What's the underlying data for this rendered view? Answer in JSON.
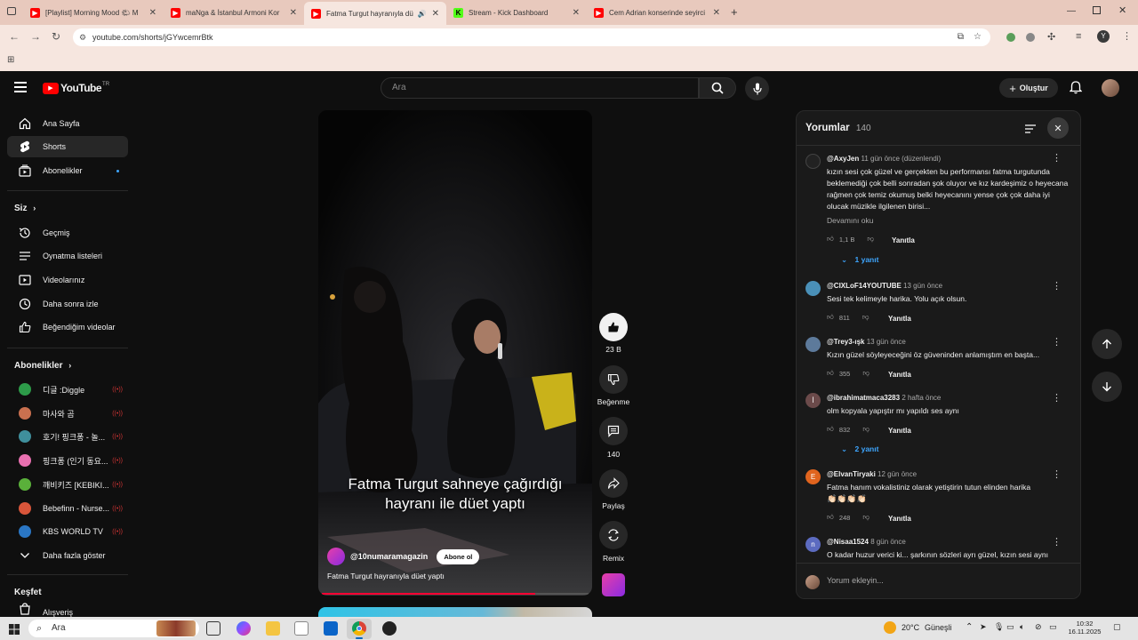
{
  "browser": {
    "tabs": [
      {
        "title": "[Playlist] Morning Mood 🌤 M",
        "favicon_color": "#ff0000"
      },
      {
        "title": "maNga & İstanbul Armoni Kor",
        "favicon_color": "#ff0000"
      },
      {
        "title": "Fatma Turgut hayranıyla dü",
        "favicon_color": "#ff0000",
        "active": true
      },
      {
        "title": "Stream - Kick Dashboard",
        "favicon_color": "#53fc18",
        "favicon_letter": "K"
      },
      {
        "title": "Cem Adrian konserinde seyirci",
        "favicon_color": "#ff0000"
      }
    ],
    "url": "youtube.com/shorts/jGYwcemrBtk",
    "profile_initial": "Y"
  },
  "youtube": {
    "logo_text": "YouTube",
    "logo_region": "TR",
    "search_placeholder": "Ara",
    "create_label": "Oluştur",
    "sidebar": {
      "main": [
        {
          "label": "Ana Sayfa",
          "icon": "home-icon"
        },
        {
          "label": "Shorts",
          "icon": "shorts-icon",
          "active": true
        },
        {
          "label": "Abonelikler",
          "icon": "subscriptions-icon"
        }
      ],
      "you_header": "Siz",
      "you": [
        {
          "label": "Geçmiş",
          "icon": "history-icon"
        },
        {
          "label": "Oynatma listeleri",
          "icon": "playlist-icon"
        },
        {
          "label": "Videolarınız",
          "icon": "video-icon"
        },
        {
          "label": "Daha sonra izle",
          "icon": "clock-icon"
        },
        {
          "label": "Beğendiğim videolar",
          "icon": "like-icon"
        }
      ],
      "subs_header": "Abonelikler",
      "subs": [
        {
          "label": "디글 :Diggle",
          "color": "#2d9b49",
          "live": "((•))"
        },
        {
          "label": "마사와 곰",
          "color": "#c9704f",
          "live": "((•))"
        },
        {
          "label": "호기! 핑크퐁 - 놀...",
          "color": "#3f8f9c",
          "live": "((•))"
        },
        {
          "label": "핑크퐁 (인기 동요...",
          "color": "#e870b0",
          "live": "((•))"
        },
        {
          "label": "깨비키즈 [KEBIKI...",
          "color": "#5ab03a",
          "live": "((•))"
        },
        {
          "label": "Bebefinn - Nurse...",
          "color": "#d8553a",
          "live": "((•))"
        },
        {
          "label": "KBS WORLD TV",
          "color": "#2a76c4",
          "live": "((•))"
        }
      ],
      "more_label": "Daha fazla göster",
      "explore_header": "Keşfet",
      "explore": [
        {
          "label": "Alışveriş",
          "icon": "shopping-icon"
        }
      ]
    },
    "video": {
      "caption_line1": "Fatma Turgut sahneye çağırdığı",
      "caption_line2": "hayranı ile düet yaptı",
      "channel": "@10numaramagazin",
      "subscribe_label": "Abone ol",
      "title": "Fatma Turgut hayranıyla düet yaptı",
      "progress": 0.8
    },
    "actions": {
      "likes": "23 B",
      "dislike_label": "Beğenme",
      "comments": "140",
      "share_label": "Paylaş",
      "remix_label": "Remix"
    },
    "comments_panel": {
      "title": "Yorumlar",
      "count": "140",
      "input_placeholder": "Yorum ekleyin...",
      "reply_label": "Yanıtla",
      "read_more": "Devamını oku",
      "items": [
        {
          "author": "@AxyJen",
          "time": "11 gün önce (düzenlendi)",
          "text": "kızın sesi çok güzel ve gerçekten bu performansı fatma turgutunda beklemediği çok belli sonradan şok oluyor ve kız kardeşimiz o heyecana rağmen çok temiz okumuş belki heyecanını yense çok çok daha iyi olucak müzikle ilgilenen birisi...",
          "likes": "1,1 B",
          "replies": "1 yanıt",
          "avatar_color": "#222"
        },
        {
          "author": "@CIXLoF14YOUTUBE",
          "time": "13 gün önce",
          "text": "Sesi tek kelimeyle harika. Yolu açık olsun.",
          "likes": "811",
          "avatar_color": "#4a90b8"
        },
        {
          "author": "@Trey3-ışk",
          "time": "13 gün önce",
          "text": "Kızın güzel söyleyeceğini öz güveninden anlamıştım en başta...",
          "likes": "355",
          "avatar_color": "#5d7a9b"
        },
        {
          "author": "@ibrahimatmaca3283",
          "time": "2 hafta önce",
          "text": "olm kopyala yapıştır mı yapıldı ses aynı",
          "likes": "832",
          "replies": "2 yanıt",
          "avatar_color": "#6b4a4a",
          "avatar_letter": "İ"
        },
        {
          "author": "@ElvanTiryaki",
          "time": "12 gün önce",
          "text": "Fatma hanım vokalistiniz olarak yetiştirin tutun elinden harika",
          "emoji": "👏🏻👏🏻👏🏻👏🏻",
          "likes": "248",
          "avatar_color": "#e0641e",
          "avatar_letter": "E"
        },
        {
          "author": "@Nisaa1524",
          "time": "8 gün önce",
          "text": "O kadar huzur verici ki... şarkının sözleri ayrı güzel,  kızın sesi aynı",
          "avatar_color": "#5c6bc0",
          "avatar_letter": "n"
        }
      ]
    }
  },
  "taskbar": {
    "search_placeholder": "Ara",
    "weather_temp": "20°C",
    "weather_text": "Güneşli",
    "time": "10:32",
    "date": "16.11.2025"
  }
}
